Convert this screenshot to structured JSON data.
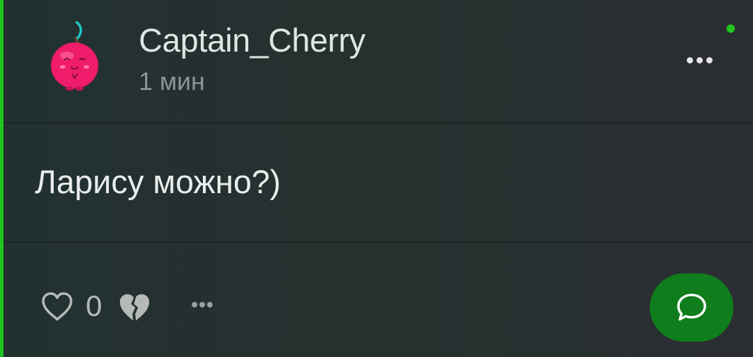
{
  "post": {
    "username": "Captain_Cherry",
    "timestamp": "1 мин",
    "message": "Ларису можно?)",
    "likes_count": "0",
    "online": true
  },
  "icons": {
    "avatar": "cherry-avatar",
    "more_top": "more-horizontal-icon",
    "like": "heart-outline-icon",
    "dislike": "broken-heart-icon",
    "more_bottom": "more-horizontal-icon",
    "comment": "chat-bubble-icon"
  },
  "colors": {
    "accent": "#1ec51e",
    "comment_button": "#0f7d1b",
    "background": "#26302f"
  }
}
